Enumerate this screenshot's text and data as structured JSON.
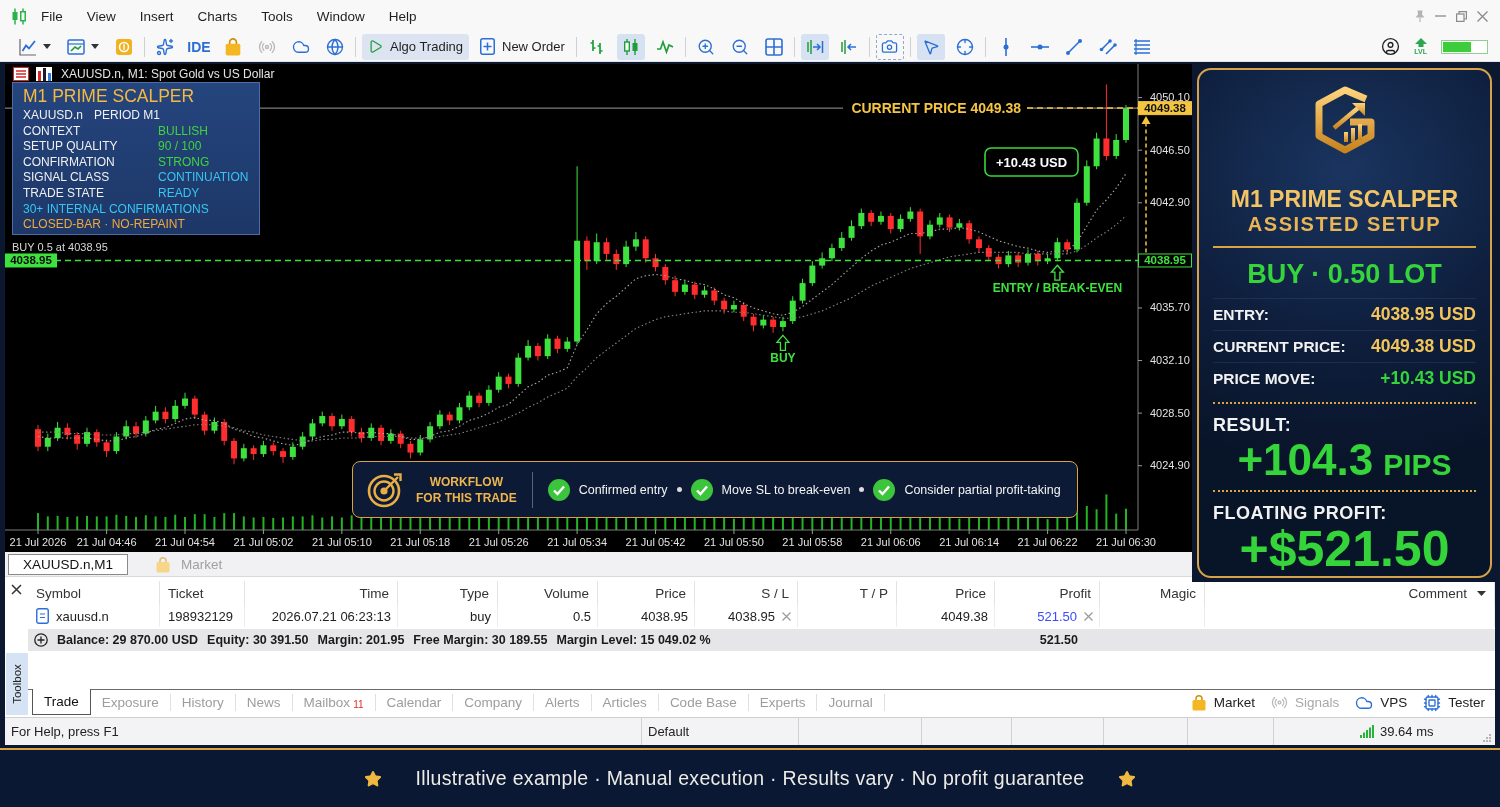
{
  "menu_bar": {
    "items": [
      "File",
      "View",
      "Insert",
      "Charts",
      "Tools",
      "Window",
      "Help"
    ]
  },
  "toolbar": {
    "ide": "IDE",
    "algo_trading": {
      "label": "Algo Trading",
      "on": true
    },
    "new_order": {
      "label": "New Order"
    },
    "chart_types": [
      {
        "selected": false
      },
      {
        "selected": true
      },
      {
        "selected": false
      }
    ],
    "auto_scroll": {
      "on": true
    },
    "chart_shift": {
      "on": false
    },
    "cursor_tools": [
      {
        "selected": true
      },
      {
        "selected": false
      }
    ],
    "level_label": "LVL",
    "level_meter": {
      "level": 0.65
    }
  },
  "chart": {
    "title": "XAUUSD.n, M1: Spot Gold vs US Dollar",
    "indicator_panel": {
      "title": "M1 PRIME SCALPER",
      "symbol": "XAUUSD.n",
      "period": "PERIOD M1",
      "rows": [
        {
          "label": "CONTEXT",
          "value": "BULLISH",
          "color": "#3fd43f"
        },
        {
          "label": "SETUP QUALITY",
          "value": "90 / 100",
          "color": "#3fd43f"
        },
        {
          "label": "CONFIRMATION",
          "value": "STRONG",
          "color": "#3fd43f"
        },
        {
          "label": "SIGNAL CLASS",
          "value": "CONTINUATION",
          "color": "#38c6f0"
        },
        {
          "label": "TRADE STATE",
          "value": "READY",
          "color": "#38c6f0"
        }
      ],
      "note": "30+ INTERNAL CONFIRMATIONS",
      "footer": "CLOSED-BAR · NO-REPAINT"
    },
    "workflow": {
      "title": [
        "WORKFLOW",
        "FOR THIS TRADE"
      ],
      "steps": [
        {
          "label": "Confirmed entry",
          "checked": true
        },
        {
          "label": "Move SL to break-even",
          "checked": true
        },
        {
          "label": "Consider partial profit-taking",
          "checked": true
        }
      ]
    },
    "price_tags": [
      {
        "text": "4049.38",
        "kind": "axis-filled",
        "color": "#f5c542"
      },
      {
        "text": "4038.95",
        "kind": "axis-outline",
        "color": "#3ee23e"
      },
      {
        "text": "4038.95",
        "kind": "left",
        "color": "#3ee23e"
      }
    ],
    "markers": [
      {
        "label": "BUY"
      },
      {
        "label": "ENTRY / BREAK-EVEN"
      }
    ],
    "chart_data": [
      {
        "type": "candlestick",
        "categories": [
          "21 Jul 2026",
          null,
          null,
          null,
          null,
          null,
          null,
          "21 Jul 04:46",
          null,
          null,
          null,
          null,
          null,
          null,
          null,
          "21 Jul 04:54",
          null,
          null,
          null,
          null,
          null,
          null,
          null,
          "21 Jul 05:02",
          null,
          null,
          null,
          null,
          null,
          null,
          null,
          "21 Jul 05:10",
          null,
          null,
          null,
          null,
          null,
          null,
          null,
          "21 Jul 05:18",
          null,
          null,
          null,
          null,
          null,
          null,
          null,
          "21 Jul 05:26",
          null,
          null,
          null,
          null,
          null,
          null,
          null,
          "21 Jul 05:34",
          null,
          null,
          null,
          null,
          null,
          null,
          null,
          "21 Jul 05:42",
          null,
          null,
          null,
          null,
          null,
          null,
          null,
          "21 Jul 05:50",
          null,
          null,
          null,
          null,
          null,
          null,
          null,
          "21 Jul 05:58",
          null,
          null,
          null,
          null,
          null,
          null,
          null,
          "21 Jul 06:06",
          null,
          null,
          null,
          null,
          null,
          null,
          null,
          "21 Jul 06:14",
          null,
          null,
          null,
          null,
          null,
          null,
          null,
          "21 Jul 06:22",
          null,
          null,
          null,
          null,
          null,
          null,
          null,
          "21 Jul 06:30"
        ],
        "ohlc": [
          [
            4027.4,
            4027.7,
            4025.9,
            4026.2
          ],
          [
            4026.2,
            4027.1,
            4025.9,
            4026.8
          ],
          [
            4026.8,
            4027.9,
            4026.6,
            4027.5
          ],
          [
            4027.5,
            4027.8,
            4026.7,
            4027.0
          ],
          [
            4027.0,
            4027.2,
            4026.0,
            4026.4
          ],
          [
            4026.4,
            4027.5,
            4026.2,
            4027.2
          ],
          [
            4027.2,
            4027.4,
            4026.2,
            4026.5
          ],
          [
            4026.5,
            4026.7,
            4025.5,
            4025.9
          ],
          [
            4025.9,
            4027.2,
            4025.7,
            4026.9
          ],
          [
            4026.9,
            4028.0,
            4026.7,
            4027.6
          ],
          [
            4027.6,
            4027.9,
            4026.8,
            4027.1
          ],
          [
            4027.1,
            4028.3,
            4026.9,
            4028.0
          ],
          [
            4028.0,
            4029.0,
            4027.8,
            4028.6
          ],
          [
            4028.6,
            4028.9,
            4027.8,
            4028.1
          ],
          [
            4028.1,
            4029.4,
            4027.9,
            4029.0
          ],
          [
            4029.0,
            4029.9,
            4028.8,
            4029.5
          ],
          [
            4029.5,
            4029.7,
            4028.1,
            4028.4
          ],
          [
            4028.4,
            4028.6,
            4027.0,
            4027.3
          ],
          [
            4027.3,
            4028.2,
            4027.1,
            4027.9
          ],
          [
            4027.9,
            4028.1,
            4026.3,
            4026.6
          ],
          [
            4026.6,
            4026.8,
            4025.0,
            4025.4
          ],
          [
            4025.4,
            4026.4,
            4025.2,
            4026.1
          ],
          [
            4026.1,
            4026.3,
            4025.3,
            4025.7
          ],
          [
            4025.7,
            4026.6,
            4025.5,
            4026.3
          ],
          [
            4026.3,
            4026.5,
            4025.6,
            4025.9
          ],
          [
            4025.9,
            4026.1,
            4025.1,
            4025.5
          ],
          [
            4025.5,
            4026.5,
            4025.3,
            4026.2
          ],
          [
            4026.2,
            4027.2,
            4026.0,
            4026.9
          ],
          [
            4026.9,
            4028.1,
            4026.7,
            4027.8
          ],
          [
            4027.8,
            4028.6,
            4027.6,
            4028.3
          ],
          [
            4028.3,
            4028.5,
            4027.3,
            4027.6
          ],
          [
            4027.6,
            4028.4,
            4027.4,
            4028.1
          ],
          [
            4028.1,
            4028.3,
            4026.9,
            4027.2
          ],
          [
            4027.2,
            4027.5,
            4026.5,
            4026.8
          ],
          [
            4026.8,
            4027.8,
            4026.6,
            4027.5
          ],
          [
            4027.5,
            4027.7,
            4026.3,
            4026.6
          ],
          [
            4026.6,
            4027.4,
            4026.4,
            4027.1
          ],
          [
            4027.1,
            4027.3,
            4026.1,
            4026.4
          ],
          [
            4026.4,
            4026.6,
            4025.4,
            4025.8
          ],
          [
            4025.8,
            4027.0,
            4025.6,
            4026.7
          ],
          [
            4026.7,
            4027.9,
            4026.5,
            4027.6
          ],
          [
            4027.6,
            4028.7,
            4027.4,
            4028.4
          ],
          [
            4028.4,
            4028.6,
            4027.7,
            4028.0
          ],
          [
            4028.0,
            4029.2,
            4027.8,
            4028.9
          ],
          [
            4028.9,
            4030.0,
            4028.7,
            4029.7
          ],
          [
            4029.7,
            4029.9,
            4028.9,
            4029.2
          ],
          [
            4029.2,
            4030.4,
            4029.0,
            4030.1
          ],
          [
            4030.1,
            4031.3,
            4029.9,
            4031.0
          ],
          [
            4031.0,
            4031.2,
            4030.2,
            4030.5
          ],
          [
            4030.5,
            4032.6,
            4030.3,
            4032.3
          ],
          [
            4032.3,
            4033.5,
            4032.1,
            4033.1
          ],
          [
            4033.1,
            4033.3,
            4032.1,
            4032.4
          ],
          [
            4032.4,
            4033.9,
            4032.2,
            4033.6
          ],
          [
            4033.6,
            4033.8,
            4032.6,
            4032.9
          ],
          [
            4032.9,
            4033.7,
            4032.7,
            4033.4
          ],
          [
            4033.4,
            4045.4,
            4033.2,
            4040.3
          ],
          [
            4040.3,
            4040.6,
            4038.3,
            4038.9
          ],
          [
            4038.9,
            4040.8,
            4038.7,
            4040.2
          ],
          [
            4040.2,
            4040.5,
            4039.0,
            4039.4
          ],
          [
            4039.4,
            4039.7,
            4038.3,
            4038.7
          ],
          [
            4038.7,
            4040.3,
            4038.5,
            4039.9
          ],
          [
            4039.9,
            4040.9,
            4039.6,
            4040.4
          ],
          [
            4040.4,
            4040.6,
            4038.8,
            4039.1
          ],
          [
            4039.1,
            4039.4,
            4038.2,
            4038.5
          ],
          [
            4038.5,
            4038.7,
            4037.3,
            4037.6
          ],
          [
            4037.6,
            4037.9,
            4036.5,
            4036.8
          ],
          [
            4036.8,
            4037.6,
            4036.6,
            4037.3
          ],
          [
            4037.3,
            4037.5,
            4036.3,
            4036.6
          ],
          [
            4036.6,
            4037.2,
            4036.4,
            4036.9
          ],
          [
            4036.9,
            4037.1,
            4035.9,
            4036.2
          ],
          [
            4036.2,
            4036.4,
            4035.3,
            4035.6
          ],
          [
            4035.6,
            4036.2,
            4035.4,
            4035.9
          ],
          [
            4035.9,
            4036.1,
            4034.8,
            4035.1
          ],
          [
            4035.1,
            4035.3,
            4034.1,
            4034.5
          ],
          [
            4034.5,
            4035.2,
            4034.3,
            4034.9
          ],
          [
            4034.9,
            4035.1,
            4034.0,
            4034.4
          ],
          [
            4034.4,
            4035.1,
            4034.1,
            4034.8
          ],
          [
            4034.8,
            4036.5,
            4034.6,
            4036.2
          ],
          [
            4036.2,
            4037.7,
            4036.0,
            4037.4
          ],
          [
            4037.4,
            4038.9,
            4037.2,
            4038.6
          ],
          [
            4038.6,
            4039.5,
            4038.4,
            4039.1
          ],
          [
            4039.1,
            4040.1,
            4038.9,
            4039.8
          ],
          [
            4039.8,
            4040.9,
            4039.6,
            4040.5
          ],
          [
            4040.5,
            4041.7,
            4040.3,
            4041.3
          ],
          [
            4041.3,
            4042.5,
            4041.1,
            4042.2
          ],
          [
            4042.2,
            4042.4,
            4041.3,
            4041.6
          ],
          [
            4041.6,
            4042.3,
            4041.4,
            4042.0
          ],
          [
            4042.0,
            4042.2,
            4040.8,
            4041.1
          ],
          [
            4041.1,
            4042.1,
            4040.9,
            4041.8
          ],
          [
            4041.8,
            4042.6,
            4041.6,
            4042.3
          ],
          [
            4042.3,
            4042.5,
            4039.4,
            4040.6
          ],
          [
            4040.6,
            4041.7,
            4040.4,
            4041.4
          ],
          [
            4041.4,
            4042.2,
            4041.2,
            4041.9
          ],
          [
            4041.9,
            4042.1,
            4040.9,
            4041.2
          ],
          [
            4041.2,
            4041.8,
            4041.0,
            4041.5
          ],
          [
            4041.5,
            4041.7,
            4040.1,
            4040.4
          ],
          [
            4040.4,
            4040.6,
            4039.5,
            4039.8
          ],
          [
            4039.8,
            4040.0,
            4038.9,
            4039.2
          ],
          [
            4039.2,
            4039.4,
            4038.4,
            4038.7
          ],
          [
            4038.7,
            4039.6,
            4038.5,
            4039.3
          ],
          [
            4039.3,
            4039.5,
            4038.5,
            4038.8
          ],
          [
            4038.8,
            4039.7,
            4038.6,
            4039.4
          ],
          [
            4039.4,
            4039.6,
            4038.6,
            4038.9
          ],
          [
            4038.9,
            4039.4,
            4038.7,
            4039.1
          ],
          [
            4039.1,
            4040.5,
            4038.9,
            4040.2
          ],
          [
            4040.2,
            4040.4,
            4039.4,
            4039.7
          ],
          [
            4039.7,
            4043.2,
            4039.5,
            4042.9
          ],
          [
            4042.9,
            4045.8,
            4042.7,
            4045.4
          ],
          [
            4045.4,
            4047.7,
            4045.2,
            4047.3
          ],
          [
            4047.3,
            4051.0,
            4045.8,
            4046.1
          ],
          [
            4046.1,
            4047.6,
            4045.9,
            4047.2
          ],
          [
            4047.2,
            4049.6,
            4047.0,
            4049.38
          ]
        ],
        "series": [
          {
            "type": "line",
            "color": "#a8a8a8",
            "line_style": "dotted",
            "values": [
              4026.9,
              4026.8,
              4026.8,
              4026.8,
              4026.8,
              4026.8,
              4026.7,
              4026.6,
              4026.6,
              4026.8,
              4026.9,
              4027.1,
              4027.4,
              4027.5,
              4027.8,
              4028.1,
              4028.2,
              4028.0,
              4028.0,
              4027.8,
              4027.4,
              4027.2,
              4026.9,
              4026.8,
              4026.6,
              4026.4,
              4026.3,
              4026.4,
              4026.7,
              4026.9,
              4027.0,
              4027.2,
              4027.2,
              4027.1,
              4027.2,
              4027.1,
              4027.1,
              4026.9,
              4026.7,
              4026.7,
              4026.9,
              4027.2,
              4027.3,
              4027.6,
              4028.0,
              4028.2,
              4028.5,
              4028.9,
              4029.1,
              4029.7,
              4030.3,
              4030.6,
              4031.1,
              4031.3,
              4031.6,
              4033.2,
              4034.2,
              4035.3,
              4036.0,
              4036.5,
              4037.1,
              4037.7,
              4037.9,
              4038.0,
              4037.9,
              4037.7,
              4037.6,
              4037.4,
              4037.3,
              4037.0,
              4036.6,
              4036.4,
              4036.0,
              4035.7,
              4035.5,
              4035.3,
              4035.2,
              4035.4,
              4035.8,
              4036.3,
              4036.8,
              4037.3,
              4037.9,
              4038.5,
              4039.1,
              4039.6,
              4040.0,
              4040.2,
              4040.5,
              4040.8,
              4040.8,
              4040.9,
              4041.1,
              4041.1,
              4041.2,
              4041.1,
              4040.9,
              4040.6,
              4040.3,
              4040.1,
              4039.9,
              4039.8,
              4039.6,
              4039.5,
              4039.6,
              4039.6,
              4040.2,
              4041.3,
              4042.4,
              4043.1,
              4043.9,
              4044.9
            ]
          },
          {
            "type": "line",
            "color": "#858585",
            "line_style": "dotted",
            "values": [
              4027.2,
              4027.2,
              4027.2,
              4027.1,
              4027.1,
              4027.1,
              4027.0,
              4027.0,
              4027.0,
              4027.1,
              4027.1,
              4027.2,
              4027.3,
              4027.4,
              4027.5,
              4027.6,
              4027.7,
              4027.7,
              4027.7,
              4027.6,
              4027.5,
              4027.3,
              4027.2,
              4027.0,
              4026.9,
              4026.8,
              4026.7,
              4026.6,
              4026.6,
              4026.7,
              4026.7,
              4026.8,
              4026.8,
              4026.8,
              4026.9,
              4026.9,
              4026.9,
              4026.9,
              4026.8,
              4026.8,
              4026.8,
              4026.9,
              4027.0,
              4027.1,
              4027.3,
              4027.5,
              4027.7,
              4027.9,
              4028.2,
              4028.5,
              4028.9,
              4029.2,
              4029.6,
              4029.9,
              4030.2,
              4031.0,
              4031.6,
              4032.3,
              4032.8,
              4033.3,
              4033.8,
              4034.3,
              4034.6,
              4034.9,
              4035.1,
              4035.2,
              4035.3,
              4035.4,
              4035.5,
              4035.5,
              4035.5,
              4035.4,
              4035.4,
              4035.3,
              4035.2,
              4035.1,
              4035.0,
              4035.0,
              4035.1,
              4035.3,
              4035.5,
              4035.8,
              4036.1,
              4036.4,
              4036.8,
              4037.2,
              4037.5,
              4037.8,
              4038.1,
              4038.4,
              4038.6,
              4038.8,
              4039.0,
              4039.2,
              4039.3,
              4039.4,
              4039.5,
              4039.5,
              4039.5,
              4039.5,
              4039.5,
              4039.4,
              4039.4,
              4039.4,
              4039.4,
              4039.4,
              4039.6,
              4040.0,
              4040.5,
              4040.9,
              4041.4,
              4042.0
            ]
          }
        ],
        "ylim": [
          4020.5,
          4052.4
        ],
        "yticks": [
          {
            "value": 4050.1,
            "label": "4050.10"
          },
          {
            "value": 4046.5,
            "label": "4046.50"
          },
          {
            "value": 4042.9,
            "label": "4042.90"
          },
          {
            "value": 4035.7,
            "label": "4035.70"
          },
          {
            "value": 4032.1,
            "label": "4032.10"
          },
          {
            "value": 4028.5,
            "label": "4028.50"
          },
          {
            "value": 4024.9,
            "label": "4024.90"
          }
        ],
        "ref_lines": [
          {
            "axis": "y",
            "value": 4049.38,
            "color": "#9a9a9a",
            "line_style": "solid"
          },
          {
            "axis": "y",
            "value": 4049.38,
            "label": "CURRENT PRICE 4049.38",
            "color": "#f5c542",
            "line_style": "dashed"
          },
          {
            "axis": "y",
            "value": 4038.95,
            "label": "BUY 0.5 at 4038.95",
            "color": "#3ee23e",
            "line_style": "dashed"
          }
        ],
        "annotations": [
          "+10.43 USD"
        ]
      }
    ]
  },
  "setup_panel": {
    "title": "M1 PRIME SCALPER",
    "subtitle": "ASSISTED SETUP",
    "signal": "BUY · 0.50 LOT",
    "rows": [
      {
        "label": "ENTRY:",
        "value": "4038.95 USD",
        "color": "#f2c45a"
      },
      {
        "label": "CURRENT PRICE:",
        "value": "4049.38 USD",
        "color": "#f2c45a"
      },
      {
        "label": "PRICE MOVE:",
        "value": "+10.43 USD",
        "color": "#35d43a"
      }
    ],
    "result": {
      "label": "RESULT:",
      "value": "+104.3",
      "unit": "PIPS"
    },
    "profit": {
      "label": "FLOATING PROFIT:",
      "value": "+$521.50"
    }
  },
  "chart_tabs": [
    {
      "label": "XAUUSD.n,M1",
      "selected": true
    },
    {
      "label": "Market",
      "selected": false
    }
  ],
  "toolbox": {
    "label": "Toolbox",
    "columns": [
      "Symbol",
      "Ticket",
      "Time",
      "Type",
      "Volume",
      "Price",
      "S / L",
      "T / P",
      "Price",
      "Profit",
      "Magic",
      "Comment"
    ],
    "rows": [
      {
        "cells": [
          "xauusd.n",
          "198932129",
          "2026.07.21 06:23:13",
          "buy",
          "0.5",
          "4038.95",
          "4038.95",
          null,
          "4049.38",
          "521.50",
          null,
          null
        ]
      }
    ],
    "summary": {
      "items": [
        "Balance: 29 870.00 USD",
        "Equity: 30 391.50",
        "Margin: 201.95",
        "Free Margin: 30 189.55",
        "Margin Level: 15 049.02 %"
      ],
      "profit": "521.50"
    },
    "tabs": [
      {
        "label": "Trade",
        "selected": true
      },
      {
        "label": "Exposure",
        "selected": false
      },
      {
        "label": "History",
        "selected": false
      },
      {
        "label": "News",
        "selected": false
      },
      {
        "label": "Mailbox",
        "count": "11",
        "selected": false
      },
      {
        "label": "Calendar",
        "selected": false
      },
      {
        "label": "Company",
        "selected": false
      },
      {
        "label": "Alerts",
        "selected": false
      },
      {
        "label": "Articles",
        "selected": false
      },
      {
        "label": "Code Base",
        "selected": false
      },
      {
        "label": "Experts",
        "selected": false
      },
      {
        "label": "Journal",
        "selected": false
      }
    ],
    "side_tabs": [
      {
        "label": "Market",
        "disabled": false
      },
      {
        "label": "Signals",
        "disabled": true
      },
      {
        "label": "VPS",
        "disabled": false
      },
      {
        "label": "Tester",
        "disabled": false
      }
    ]
  },
  "status_bar": {
    "help": "For Help, press F1",
    "profile": "Default",
    "ping": "39.64 ms"
  },
  "footer_banner": {
    "text": "Illustrative example · Manual execution · Results vary · No profit guarantee"
  }
}
